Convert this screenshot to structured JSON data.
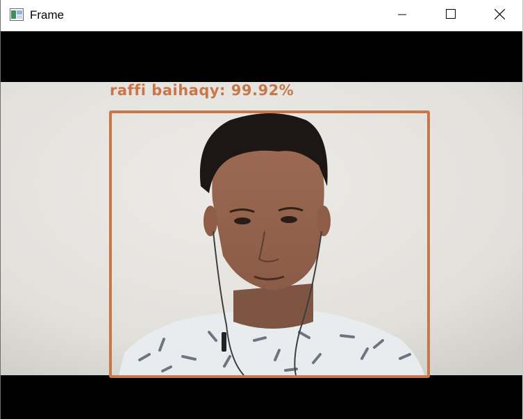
{
  "window": {
    "title": "Frame",
    "icons": {
      "app": "window-app-icon",
      "minimize": "minimize-icon",
      "maximize": "maximize-icon",
      "close": "close-icon"
    }
  },
  "detection": {
    "label": "raffi baihaqy: 99.92%",
    "color": "#c8764a"
  },
  "colors": {
    "background_wall": "#e6e4df",
    "letterbox": "#000000"
  }
}
